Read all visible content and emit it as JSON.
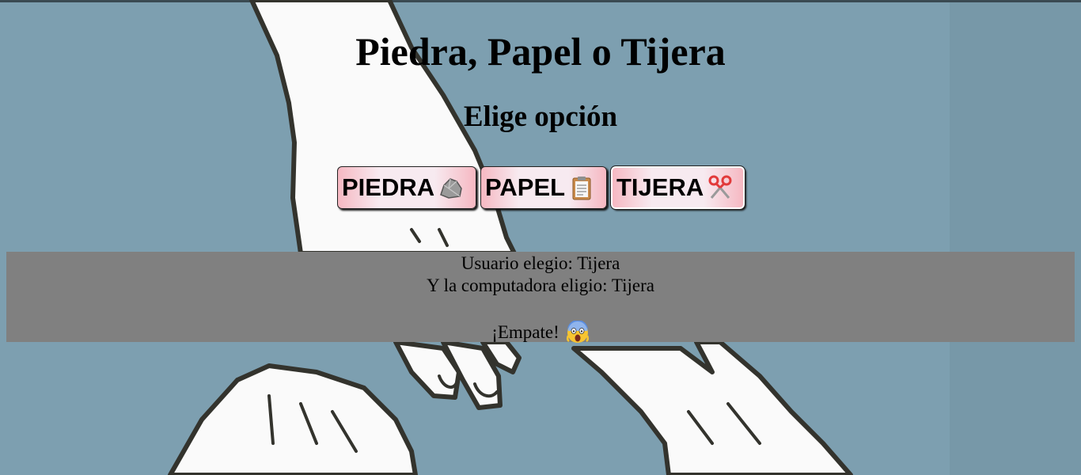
{
  "page": {
    "title": "Piedra, Papel o Tijera",
    "subtitle": "Elige opción"
  },
  "buttons": [
    {
      "label": "PIEDRA",
      "icon": "rock-icon"
    },
    {
      "label": "PAPEL",
      "icon": "clipboard-icon"
    },
    {
      "label": "TIJERA",
      "icon": "scissors-icon"
    }
  ],
  "result": {
    "user_line": "Usuario elegio: Tijera",
    "computer_line": "Y la computadora eligio: Tijera",
    "verdict": "¡Empate!",
    "verdict_icon": "screaming-face-icon"
  },
  "colors": {
    "background": "#7d9fb0",
    "result_panel": "#808080",
    "button_gradient_edge": "#f6b8c2",
    "button_gradient_center": "#f7eaf0"
  }
}
